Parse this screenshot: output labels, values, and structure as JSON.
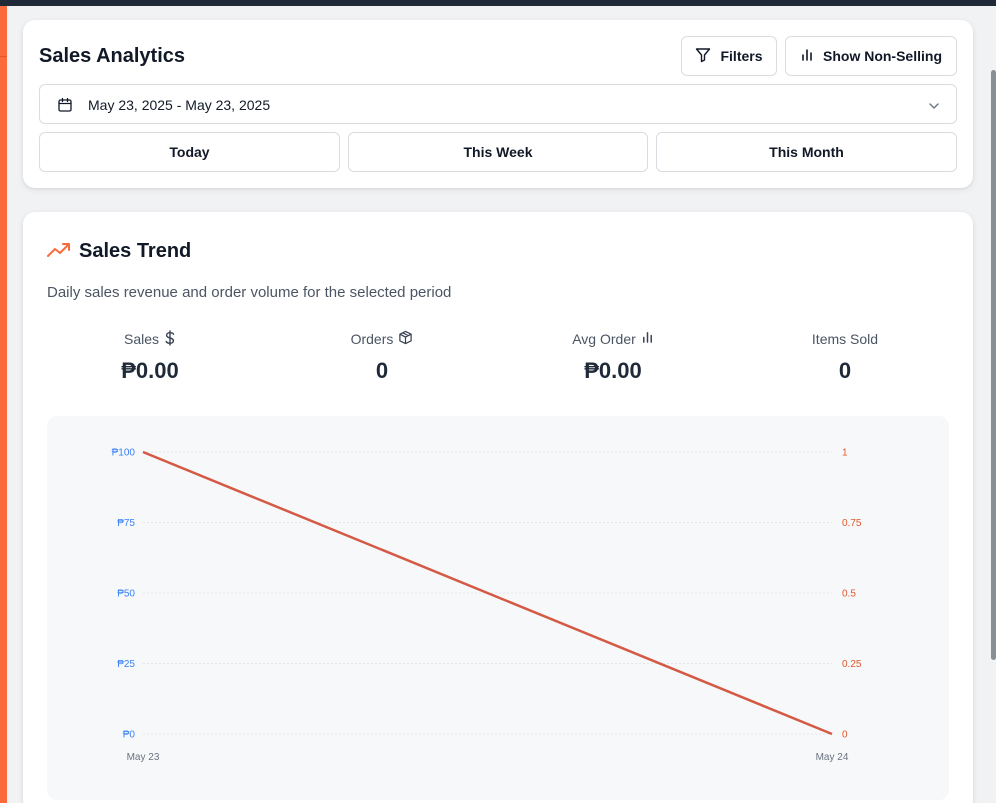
{
  "header": {
    "title": "Sales Analytics",
    "filters_label": "Filters",
    "non_selling_label": "Show Non-Selling"
  },
  "date_picker": {
    "value": "May 23, 2025 - May 23, 2025"
  },
  "ranges": [
    "Today",
    "This Week",
    "This Month"
  ],
  "trend": {
    "title": "Sales Trend",
    "description": "Daily sales revenue and order volume for the selected period"
  },
  "stats": [
    {
      "label": "Sales",
      "value": "₱0.00",
      "icon": "dollar-icon"
    },
    {
      "label": "Orders",
      "value": "0",
      "icon": "box-icon"
    },
    {
      "label": "Avg Order",
      "value": "₱0.00",
      "icon": "bar-chart-icon"
    },
    {
      "label": "Items Sold",
      "value": "0",
      "icon": ""
    }
  ],
  "colors": {
    "accent": "#fb6a3a",
    "line": "#d45a45",
    "left_axis": "#3b82f6",
    "right_axis": "#e0582a"
  },
  "chart_data": {
    "type": "line",
    "x": [
      "May 23",
      "May 24"
    ],
    "series": [
      {
        "values": [
          100,
          0
        ],
        "axis": "left"
      }
    ],
    "left_axis": {
      "ylim": [
        0,
        100
      ],
      "ticks": [
        0,
        25,
        50,
        75,
        100
      ],
      "tick_labels": [
        "₱0",
        "₱25",
        "₱50",
        "₱75",
        "₱100"
      ]
    },
    "right_axis": {
      "ylim": [
        0,
        1
      ],
      "ticks": [
        0,
        0.25,
        0.5,
        0.75,
        1
      ],
      "tick_labels": [
        "0",
        "0.25",
        "0.5",
        "0.75",
        "1"
      ]
    },
    "grid": true
  }
}
